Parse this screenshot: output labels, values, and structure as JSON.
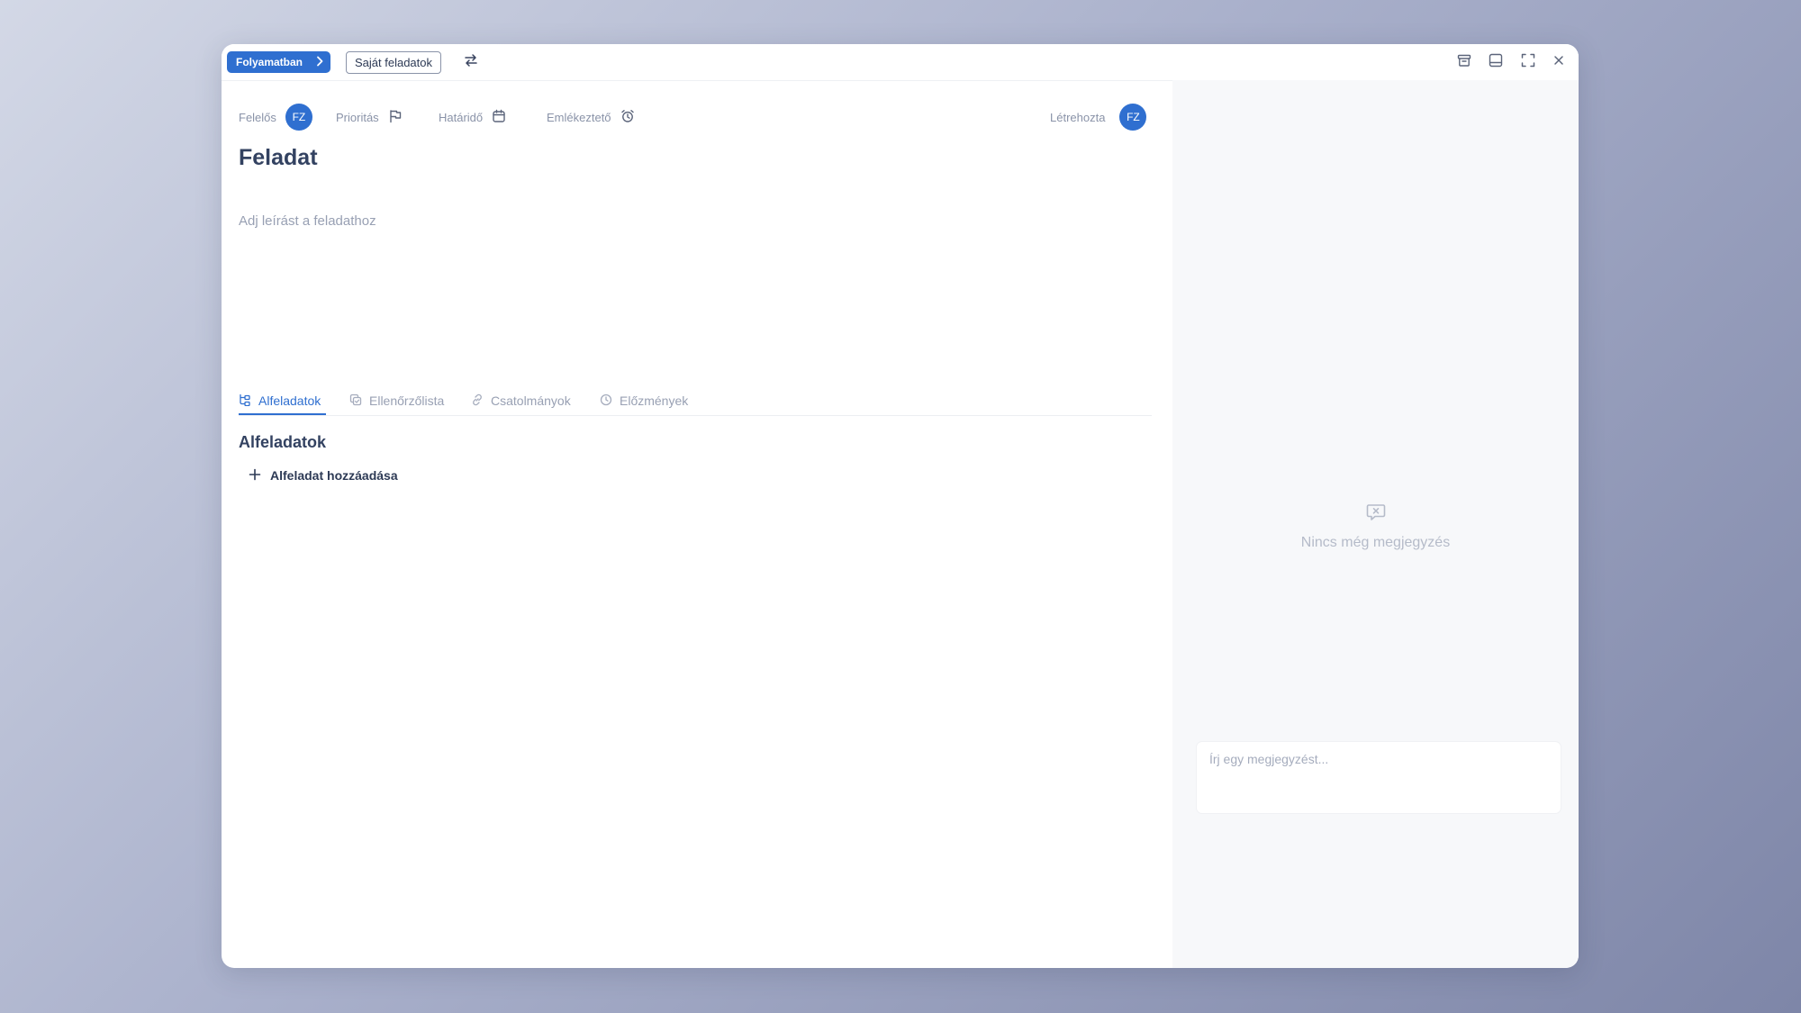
{
  "topbar": {
    "status_label": "Folyamatban",
    "list_label": "Saját feladatok",
    "icons": {
      "status_chevron": "chevron-right-icon",
      "swap": "swap-arrows-icon",
      "archive": "archive-icon",
      "sidebar": "panel-bottom-icon",
      "fullscreen": "fullscreen-icon",
      "close": "close-icon"
    }
  },
  "meta": {
    "assignee_label": "Felelős",
    "assignee_initials": "FZ",
    "priority_label": "Prioritás",
    "deadline_label": "Határidő",
    "reminder_label": "Emlékeztető",
    "creator_label": "Létrehozta",
    "creator_initials": "FZ"
  },
  "task": {
    "title": "Feladat",
    "description_placeholder": "Adj leírást a feladathoz"
  },
  "tabs": [
    {
      "label": "Alfeladatok",
      "icon": "subtasks-icon",
      "active": true
    },
    {
      "label": "Ellenőrzőlista",
      "icon": "checklist-icon",
      "active": false
    },
    {
      "label": "Csatolmányok",
      "icon": "link-icon",
      "active": false
    },
    {
      "label": "Előzmények",
      "icon": "history-icon",
      "active": false
    }
  ],
  "subtasks": {
    "section_title": "Alfeladatok",
    "add_label": "Alfeladat hozzáadása"
  },
  "comments": {
    "empty_message": "Nincs még megjegyzés",
    "input_placeholder": "Írj egy megjegyzést...",
    "input_value": ""
  },
  "colors": {
    "accent": "#2f6fd0",
    "title_text": "#334261",
    "muted_text": "#98a0b3"
  }
}
